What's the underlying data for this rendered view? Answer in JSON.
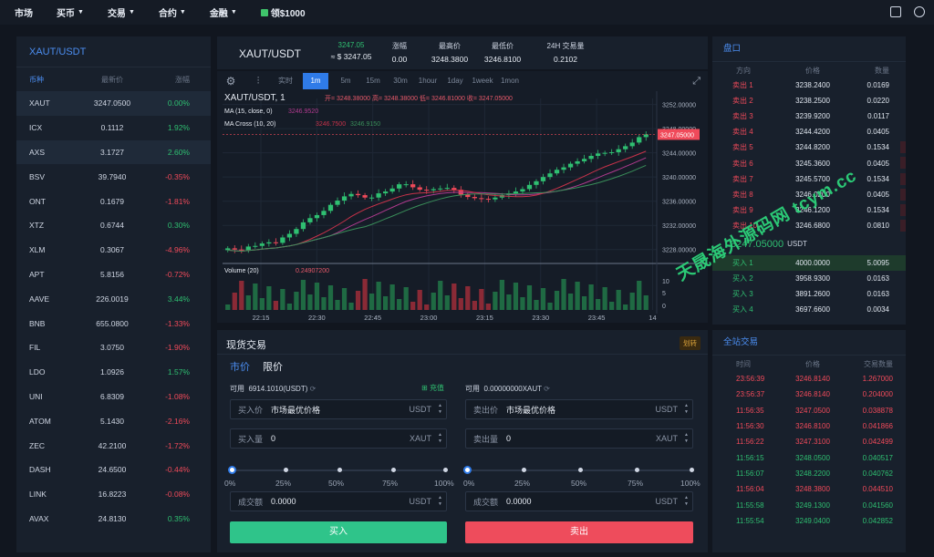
{
  "nav": {
    "items": [
      "市场",
      "买币",
      "交易",
      "合约",
      "金融"
    ],
    "gift": "领$1000"
  },
  "left": {
    "title": "XAUT/USDT",
    "headers": [
      "币种",
      "最新价",
      "涨幅"
    ],
    "rows": [
      {
        "sym": "XAUT",
        "price": "3247.0500",
        "chg": "0.00%",
        "dir": "up",
        "sel": true
      },
      {
        "sym": "ICX",
        "price": "0.1112",
        "chg": "1.92%",
        "dir": "up"
      },
      {
        "sym": "AXS",
        "price": "3.1727",
        "chg": "2.60%",
        "dir": "up",
        "sel": true
      },
      {
        "sym": "BSV",
        "price": "39.7940",
        "chg": "-0.35%",
        "dir": "down"
      },
      {
        "sym": "ONT",
        "price": "0.1679",
        "chg": "-1.81%",
        "dir": "down"
      },
      {
        "sym": "XTZ",
        "price": "0.6744",
        "chg": "0.30%",
        "dir": "up"
      },
      {
        "sym": "XLM",
        "price": "0.3067",
        "chg": "-4.96%",
        "dir": "down"
      },
      {
        "sym": "APT",
        "price": "5.8156",
        "chg": "-0.72%",
        "dir": "down"
      },
      {
        "sym": "AAVE",
        "price": "226.0019",
        "chg": "3.44%",
        "dir": "up"
      },
      {
        "sym": "BNB",
        "price": "655.0800",
        "chg": "-1.33%",
        "dir": "down"
      },
      {
        "sym": "FIL",
        "price": "3.0750",
        "chg": "-1.90%",
        "dir": "down"
      },
      {
        "sym": "LDO",
        "price": "1.0926",
        "chg": "1.57%",
        "dir": "up"
      },
      {
        "sym": "UNI",
        "price": "6.8309",
        "chg": "-1.08%",
        "dir": "down"
      },
      {
        "sym": "ATOM",
        "price": "5.1430",
        "chg": "-2.16%",
        "dir": "down"
      },
      {
        "sym": "ZEC",
        "price": "42.2100",
        "chg": "-1.72%",
        "dir": "down"
      },
      {
        "sym": "DASH",
        "price": "24.6500",
        "chg": "-0.44%",
        "dir": "down"
      },
      {
        "sym": "LINK",
        "price": "16.8223",
        "chg": "-0.08%",
        "dir": "down"
      },
      {
        "sym": "AVAX",
        "price": "24.8130",
        "chg": "0.35%",
        "dir": "up"
      }
    ]
  },
  "stats": {
    "pair": "XAUT/USDT",
    "last": "3247.05",
    "last_usd": "≈ $ 3247.05",
    "chg_label": "涨幅",
    "chg": "0.00",
    "high_label": "最高价",
    "high": "3248.3800",
    "low_label": "最低价",
    "low": "3246.8100",
    "vol_label": "24H 交易量",
    "vol": "0.2102"
  },
  "chart": {
    "timeframes": [
      "实时",
      "1m",
      "5m",
      "15m",
      "30m",
      "1hour",
      "1day",
      "1week",
      "1mon"
    ],
    "active_tf": "1m",
    "legend_title": "XAUT/USDT, 1",
    "ohlc": "开= 3248.38000 高= 3248.38000 低= 3246.81000 收= 3247.05000",
    "ma15": "MA (15, close, 0)",
    "ma15_val": "3246.9520",
    "macross": "MA Cross (10, 20)",
    "macross_v1": "3246.7500",
    "macross_v2": "3246.9150",
    "volume_label": "Volume (20)",
    "volume_val": "0.24907200",
    "price_tag": "3247.05000",
    "y_ticks": [
      "3252.00000",
      "3248.00000",
      "3244.00000",
      "3240.00000",
      "3236.00000",
      "3232.00000",
      "3228.00000"
    ],
    "vol_ticks": [
      "10",
      "5",
      "0"
    ],
    "x_ticks": [
      "22:15",
      "22:30",
      "22:45",
      "23:00",
      "23:15",
      "23:30",
      "23:45",
      "14"
    ]
  },
  "chart_data": {
    "type": "candlestick",
    "y_range": [
      3226,
      3253
    ],
    "close_series": [
      3228.2,
      3228.0,
      3227.9,
      3228.5,
      3228.6,
      3229.0,
      3229.2,
      3229.1,
      3230.0,
      3230.6,
      3231.4,
      3232.5,
      3233.2,
      3233.7,
      3234.4,
      3235.4,
      3236.1,
      3236.8,
      3237.2,
      3237.0,
      3236.6,
      3236.6,
      3237.3,
      3237.6,
      3238.1,
      3238.8,
      3238.8,
      3238.3,
      3237.9,
      3237.8,
      3238.0,
      3238.1,
      3238.2,
      3237.9,
      3237.1,
      3236.7,
      3236.5,
      3236.4,
      3236.3,
      3236.6,
      3237.0,
      3237.3,
      3237.6,
      3238.0,
      3238.7,
      3239.3,
      3240.0,
      3240.6,
      3241.2,
      3241.6,
      3242.2,
      3242.6,
      3243.0,
      3243.5,
      3243.9,
      3244.0,
      3244.1,
      3244.6,
      3245.1,
      3245.7,
      3246.6,
      3247.05
    ]
  },
  "trade": {
    "tab_title": "现货交易",
    "badge": "划转",
    "mode_market": "市价",
    "mode_limit": "限价",
    "avail_label": "可用",
    "buy_avail": "6914.1010(USDT)",
    "deposit": "充值",
    "sell_avail": "0.00000000XAUT",
    "buy_price_label": "买入价",
    "buy_price": "市场最优价格",
    "buy_price_unit": "USDT",
    "buy_qty_label": "买入量",
    "buy_qty": "0",
    "buy_qty_unit": "XAUT",
    "sell_price_label": "卖出价",
    "sell_price": "市场最优价格",
    "sell_price_unit": "USDT",
    "sell_qty_label": "卖出量",
    "sell_qty": "0",
    "sell_qty_unit": "XAUT",
    "pcts": [
      "0%",
      "25%",
      "50%",
      "75%",
      "100%"
    ],
    "buy_amount_label": "成交额",
    "buy_amount": "0.0000",
    "buy_amount_unit": "USDT",
    "sell_amount_label": "成交额",
    "sell_amount": "0.0000",
    "sell_amount_unit": "USDT",
    "buy_btn": "买入",
    "sell_btn": "卖出"
  },
  "book": {
    "title": "盘口",
    "headers": [
      "方向",
      "价格",
      "数量"
    ],
    "asks": [
      {
        "side": "卖出 1",
        "price": "3238.2400",
        "qty": "0.0169",
        "depth": 0
      },
      {
        "side": "卖出 2",
        "price": "3238.2500",
        "qty": "0.0220",
        "depth": 0
      },
      {
        "side": "卖出 3",
        "price": "3239.9200",
        "qty": "0.0117",
        "depth": 0
      },
      {
        "side": "卖出 4",
        "price": "3244.4200",
        "qty": "0.0405",
        "depth": 0
      },
      {
        "side": "卖出 5",
        "price": "3244.8200",
        "qty": "0.1534",
        "depth": 0.03
      },
      {
        "side": "卖出 6",
        "price": "3245.3600",
        "qty": "0.0405",
        "depth": 0.03
      },
      {
        "side": "卖出 7",
        "price": "3245.5700",
        "qty": "0.1534",
        "depth": 0.03
      },
      {
        "side": "卖出 8",
        "price": "3246.0200",
        "qty": "0.0405",
        "depth": 0.03
      },
      {
        "side": "卖出 9",
        "price": "3246.1200",
        "qty": "0.1534",
        "depth": 0.03
      },
      {
        "side": "卖出 10",
        "price": "3246.6800",
        "qty": "0.0810",
        "depth": 0.03
      }
    ],
    "mid": "3247.05000",
    "mid_unit": "USDT",
    "bids": [
      {
        "side": "买入 1",
        "price": "4000.0000",
        "qty": "5.0095",
        "sel": true
      },
      {
        "side": "买入 2",
        "price": "3958.9300",
        "qty": "0.0163"
      },
      {
        "side": "买入 3",
        "price": "3891.2600",
        "qty": "0.0163"
      },
      {
        "side": "买入 4",
        "price": "3697.6600",
        "qty": "0.0034"
      }
    ]
  },
  "trades": {
    "title": "全站交易",
    "headers": [
      "时间",
      "价格",
      "交易数量"
    ],
    "rows": [
      {
        "t": "23:56:39",
        "p": "3246.8140",
        "q": "1.267000",
        "dir": "down"
      },
      {
        "t": "23:56:37",
        "p": "3246.8140",
        "q": "0.204000",
        "dir": "down"
      },
      {
        "t": "11:56:35",
        "p": "3247.0500",
        "q": "0.038878",
        "dir": "down"
      },
      {
        "t": "11:56:30",
        "p": "3246.8100",
        "q": "0.041866",
        "dir": "down"
      },
      {
        "t": "11:56:22",
        "p": "3247.3100",
        "q": "0.042499",
        "dir": "down"
      },
      {
        "t": "11:56:15",
        "p": "3248.0500",
        "q": "0.040517",
        "dir": "up"
      },
      {
        "t": "11:56:07",
        "p": "3248.2200",
        "q": "0.040762",
        "dir": "up"
      },
      {
        "t": "11:56:04",
        "p": "3248.3800",
        "q": "0.044510",
        "dir": "down"
      },
      {
        "t": "11:55:58",
        "p": "3249.1300",
        "q": "0.041560",
        "dir": "up"
      },
      {
        "t": "11:55:54",
        "p": "3249.0400",
        "q": "0.042852",
        "dir": "up"
      }
    ]
  },
  "watermark": "天晟海外源码网 tcym.cc",
  "colors": {
    "up": "#2fbf71",
    "down": "#f04a5a",
    "accent": "#2f7be8",
    "buy": "#2fc48a",
    "sell": "#ee4c5c"
  }
}
